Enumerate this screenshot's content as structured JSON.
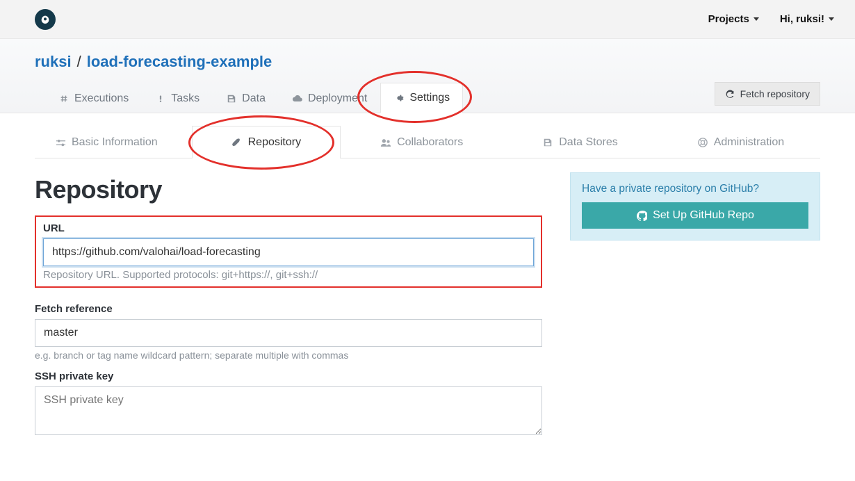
{
  "topbar": {
    "projects_label": "Projects",
    "user_greeting": "Hi, ruksi!"
  },
  "breadcrumb": {
    "owner": "ruksi",
    "separator": "/",
    "project": "load-forecasting-example"
  },
  "main_tabs": {
    "executions": "Executions",
    "tasks": "Tasks",
    "data": "Data",
    "deployment": "Deployment",
    "settings": "Settings"
  },
  "fetch_button": "Fetch repository",
  "sub_tabs": {
    "basic": "Basic Information",
    "repository": "Repository",
    "collaborators": "Collaborators",
    "data_stores": "Data Stores",
    "administration": "Administration"
  },
  "page": {
    "title": "Repository"
  },
  "form": {
    "url": {
      "label": "URL",
      "value": "https://github.com/valohai/load-forecasting",
      "help": "Repository URL. Supported protocols: git+https://, git+ssh://"
    },
    "fetch_ref": {
      "label": "Fetch reference",
      "value": "master",
      "help": "e.g. branch or tag name wildcard pattern; separate multiple with commas"
    },
    "ssh_key": {
      "label": "SSH private key",
      "placeholder": "SSH private key"
    }
  },
  "github_box": {
    "title": "Have a private repository on GitHub?",
    "button": "Set Up GitHub Repo"
  }
}
